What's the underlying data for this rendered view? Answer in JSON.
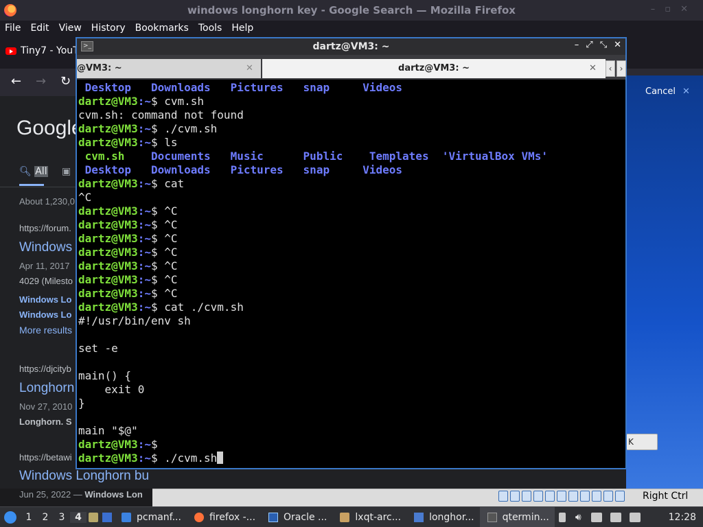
{
  "firefox": {
    "title": "windows longhorn key - Google Search — Mozilla Firefox",
    "menu": [
      "File",
      "Edit",
      "View",
      "History",
      "Bookmarks",
      "Tools",
      "Help"
    ],
    "tab_label": "Tiny7 - YouT",
    "google": {
      "logo": "Google",
      "tab_all": "All",
      "about": "About 1,230,0",
      "results": [
        {
          "url": "https://forum.",
          "title": "Windows",
          "date": "Apr 11, 2017",
          "text": "4029 (Milesto",
          "links": [
            "Windows Lo",
            "Windows Lo"
          ],
          "more": "More results"
        },
        {
          "url": "https://djcityb",
          "title": "Longhorn",
          "date": "Nov 27, 2010",
          "text": "Longhorn. S"
        },
        {
          "url": "https://betawi",
          "title": "Windows Longhorn bu",
          "date": "Jun 25, 2022 — ",
          "text": "Windows Lon"
        }
      ]
    }
  },
  "vbox": {
    "cancel": "Cancel",
    "ok": "K",
    "right_ctrl": "Right Ctrl"
  },
  "terminal": {
    "title": "dartz@VM3: ~",
    "tab1": "@VM3: ~",
    "tab2": "dartz@VM3: ~",
    "user": "dartz@VM3",
    "path": ":~",
    "prompt_suffix": "$ "
  },
  "taskbar": {
    "desktops": [
      "1",
      "2",
      "3",
      "4"
    ],
    "tasks": [
      "pcmanf...",
      "firefox -...",
      "Oracle ...",
      "lxqt-arc...",
      "longhor...",
      "qtermin..."
    ],
    "clock": "12:28"
  },
  "colors": {
    "prompt_user": "#7fe03b",
    "dir": "#6e7cff",
    "accent": "#3a78c8"
  }
}
